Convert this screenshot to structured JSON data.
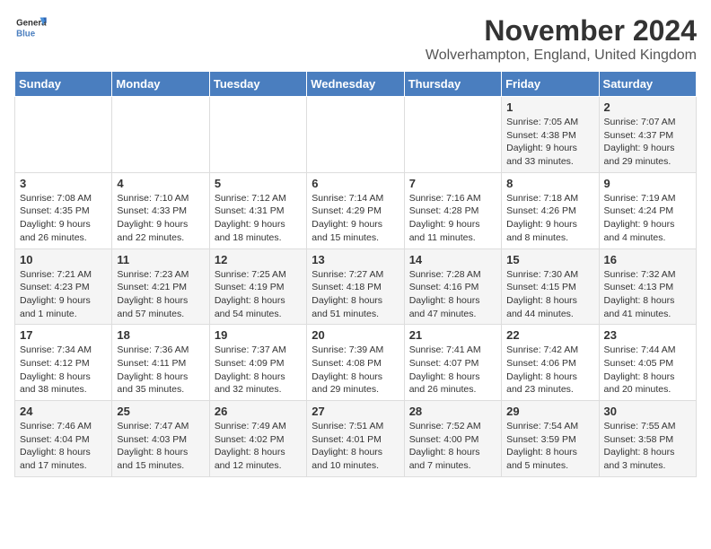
{
  "header": {
    "logo_line1": "General",
    "logo_line2": "Blue",
    "month_title": "November 2024",
    "location": "Wolverhampton, England, United Kingdom"
  },
  "weekdays": [
    "Sunday",
    "Monday",
    "Tuesday",
    "Wednesday",
    "Thursday",
    "Friday",
    "Saturday"
  ],
  "weeks": [
    [
      {
        "day": "",
        "sunrise": "",
        "sunset": "",
        "daylight": ""
      },
      {
        "day": "",
        "sunrise": "",
        "sunset": "",
        "daylight": ""
      },
      {
        "day": "",
        "sunrise": "",
        "sunset": "",
        "daylight": ""
      },
      {
        "day": "",
        "sunrise": "",
        "sunset": "",
        "daylight": ""
      },
      {
        "day": "",
        "sunrise": "",
        "sunset": "",
        "daylight": ""
      },
      {
        "day": "1",
        "sunrise": "Sunrise: 7:05 AM",
        "sunset": "Sunset: 4:38 PM",
        "daylight": "Daylight: 9 hours and 33 minutes."
      },
      {
        "day": "2",
        "sunrise": "Sunrise: 7:07 AM",
        "sunset": "Sunset: 4:37 PM",
        "daylight": "Daylight: 9 hours and 29 minutes."
      }
    ],
    [
      {
        "day": "3",
        "sunrise": "Sunrise: 7:08 AM",
        "sunset": "Sunset: 4:35 PM",
        "daylight": "Daylight: 9 hours and 26 minutes."
      },
      {
        "day": "4",
        "sunrise": "Sunrise: 7:10 AM",
        "sunset": "Sunset: 4:33 PM",
        "daylight": "Daylight: 9 hours and 22 minutes."
      },
      {
        "day": "5",
        "sunrise": "Sunrise: 7:12 AM",
        "sunset": "Sunset: 4:31 PM",
        "daylight": "Daylight: 9 hours and 18 minutes."
      },
      {
        "day": "6",
        "sunrise": "Sunrise: 7:14 AM",
        "sunset": "Sunset: 4:29 PM",
        "daylight": "Daylight: 9 hours and 15 minutes."
      },
      {
        "day": "7",
        "sunrise": "Sunrise: 7:16 AM",
        "sunset": "Sunset: 4:28 PM",
        "daylight": "Daylight: 9 hours and 11 minutes."
      },
      {
        "day": "8",
        "sunrise": "Sunrise: 7:18 AM",
        "sunset": "Sunset: 4:26 PM",
        "daylight": "Daylight: 9 hours and 8 minutes."
      },
      {
        "day": "9",
        "sunrise": "Sunrise: 7:19 AM",
        "sunset": "Sunset: 4:24 PM",
        "daylight": "Daylight: 9 hours and 4 minutes."
      }
    ],
    [
      {
        "day": "10",
        "sunrise": "Sunrise: 7:21 AM",
        "sunset": "Sunset: 4:23 PM",
        "daylight": "Daylight: 9 hours and 1 minute."
      },
      {
        "day": "11",
        "sunrise": "Sunrise: 7:23 AM",
        "sunset": "Sunset: 4:21 PM",
        "daylight": "Daylight: 8 hours and 57 minutes."
      },
      {
        "day": "12",
        "sunrise": "Sunrise: 7:25 AM",
        "sunset": "Sunset: 4:19 PM",
        "daylight": "Daylight: 8 hours and 54 minutes."
      },
      {
        "day": "13",
        "sunrise": "Sunrise: 7:27 AM",
        "sunset": "Sunset: 4:18 PM",
        "daylight": "Daylight: 8 hours and 51 minutes."
      },
      {
        "day": "14",
        "sunrise": "Sunrise: 7:28 AM",
        "sunset": "Sunset: 4:16 PM",
        "daylight": "Daylight: 8 hours and 47 minutes."
      },
      {
        "day": "15",
        "sunrise": "Sunrise: 7:30 AM",
        "sunset": "Sunset: 4:15 PM",
        "daylight": "Daylight: 8 hours and 44 minutes."
      },
      {
        "day": "16",
        "sunrise": "Sunrise: 7:32 AM",
        "sunset": "Sunset: 4:13 PM",
        "daylight": "Daylight: 8 hours and 41 minutes."
      }
    ],
    [
      {
        "day": "17",
        "sunrise": "Sunrise: 7:34 AM",
        "sunset": "Sunset: 4:12 PM",
        "daylight": "Daylight: 8 hours and 38 minutes."
      },
      {
        "day": "18",
        "sunrise": "Sunrise: 7:36 AM",
        "sunset": "Sunset: 4:11 PM",
        "daylight": "Daylight: 8 hours and 35 minutes."
      },
      {
        "day": "19",
        "sunrise": "Sunrise: 7:37 AM",
        "sunset": "Sunset: 4:09 PM",
        "daylight": "Daylight: 8 hours and 32 minutes."
      },
      {
        "day": "20",
        "sunrise": "Sunrise: 7:39 AM",
        "sunset": "Sunset: 4:08 PM",
        "daylight": "Daylight: 8 hours and 29 minutes."
      },
      {
        "day": "21",
        "sunrise": "Sunrise: 7:41 AM",
        "sunset": "Sunset: 4:07 PM",
        "daylight": "Daylight: 8 hours and 26 minutes."
      },
      {
        "day": "22",
        "sunrise": "Sunrise: 7:42 AM",
        "sunset": "Sunset: 4:06 PM",
        "daylight": "Daylight: 8 hours and 23 minutes."
      },
      {
        "day": "23",
        "sunrise": "Sunrise: 7:44 AM",
        "sunset": "Sunset: 4:05 PM",
        "daylight": "Daylight: 8 hours and 20 minutes."
      }
    ],
    [
      {
        "day": "24",
        "sunrise": "Sunrise: 7:46 AM",
        "sunset": "Sunset: 4:04 PM",
        "daylight": "Daylight: 8 hours and 17 minutes."
      },
      {
        "day": "25",
        "sunrise": "Sunrise: 7:47 AM",
        "sunset": "Sunset: 4:03 PM",
        "daylight": "Daylight: 8 hours and 15 minutes."
      },
      {
        "day": "26",
        "sunrise": "Sunrise: 7:49 AM",
        "sunset": "Sunset: 4:02 PM",
        "daylight": "Daylight: 8 hours and 12 minutes."
      },
      {
        "day": "27",
        "sunrise": "Sunrise: 7:51 AM",
        "sunset": "Sunset: 4:01 PM",
        "daylight": "Daylight: 8 hours and 10 minutes."
      },
      {
        "day": "28",
        "sunrise": "Sunrise: 7:52 AM",
        "sunset": "Sunset: 4:00 PM",
        "daylight": "Daylight: 8 hours and 7 minutes."
      },
      {
        "day": "29",
        "sunrise": "Sunrise: 7:54 AM",
        "sunset": "Sunset: 3:59 PM",
        "daylight": "Daylight: 8 hours and 5 minutes."
      },
      {
        "day": "30",
        "sunrise": "Sunrise: 7:55 AM",
        "sunset": "Sunset: 3:58 PM",
        "daylight": "Daylight: 8 hours and 3 minutes."
      }
    ]
  ]
}
